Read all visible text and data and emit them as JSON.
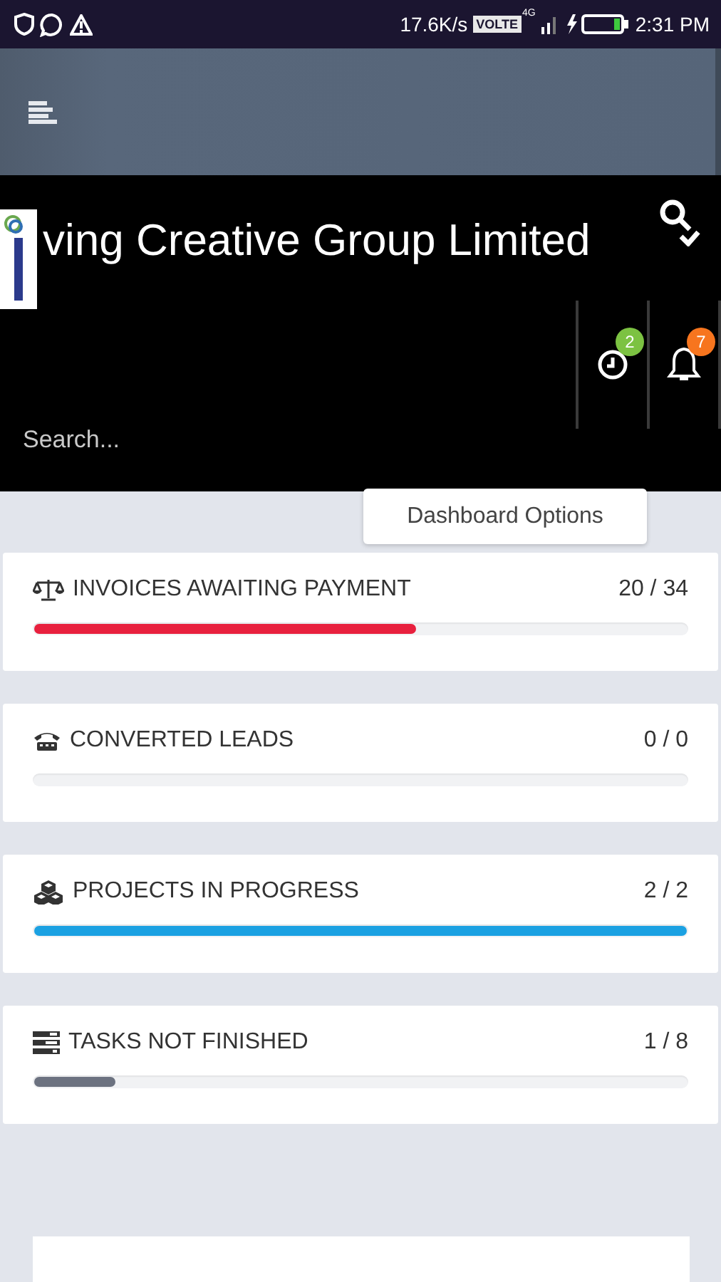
{
  "status_bar": {
    "speed": "17.6K/s",
    "volte": "VOLTE",
    "network": "4G",
    "time": "2:31 PM"
  },
  "header": {
    "title": "ving Creative Group Limited",
    "badges": [
      {
        "count": "2",
        "color": "#7cc242"
      },
      {
        "count": "7",
        "color": "#f7751e"
      }
    ],
    "search": {
      "placeholder": "Search..."
    }
  },
  "dashboard_options": "Dashboard Options",
  "stats": [
    {
      "label": "INVOICES AWAITING PAYMENT",
      "value": "20 / 34",
      "level": 0.585,
      "color": "#e8203e"
    },
    {
      "label": "CONVERTED LEADS",
      "value": "0 / 0"
    },
    {
      "label": "PROJECTS IN PROGRESS",
      "value": "2 / 2",
      "level": 1,
      "color": "#1ba1e2"
    },
    {
      "label": "TASKS NOT FINISHED",
      "value": "1 / 8",
      "level": 0.124,
      "color": "#6c7280"
    }
  ]
}
